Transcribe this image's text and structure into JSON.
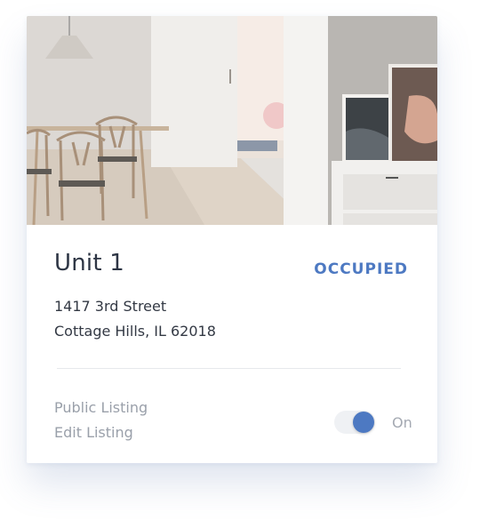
{
  "unit": {
    "title": "Unit 1",
    "status": "OCCUPIED",
    "address_line1": "1417 3rd Street",
    "address_line2": "Cottage Hills, IL 62018"
  },
  "links": {
    "public_listing": "Public Listing",
    "edit_listing": "Edit Listing"
  },
  "toggle": {
    "state": "On",
    "on": true
  },
  "colors": {
    "accent": "#4d79c2",
    "title": "#2d3544",
    "muted": "#9aa0aa"
  }
}
